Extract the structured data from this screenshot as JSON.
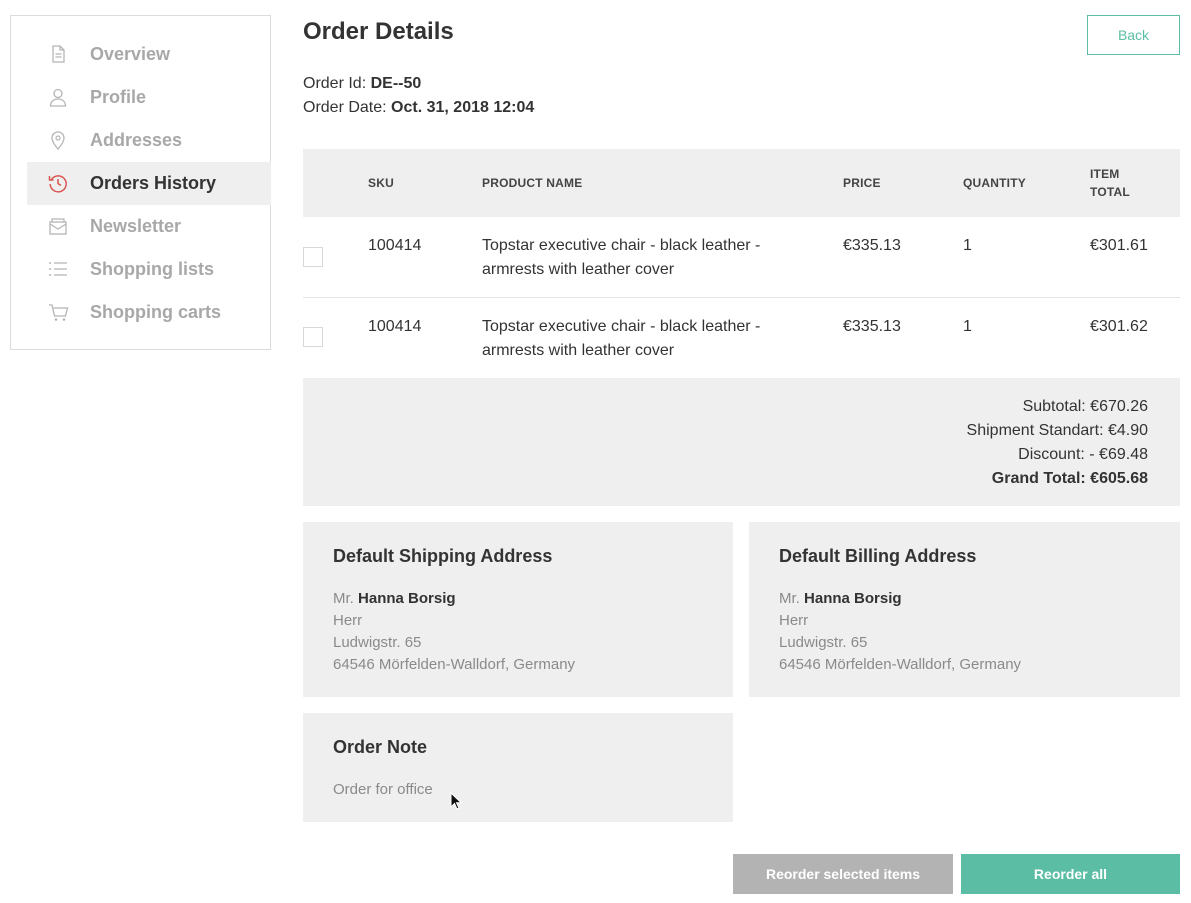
{
  "sidebar": {
    "items": [
      {
        "label": "Overview",
        "icon": "document-icon",
        "active": false
      },
      {
        "label": "Profile",
        "icon": "user-icon",
        "active": false
      },
      {
        "label": "Addresses",
        "icon": "location-pin-icon",
        "active": false
      },
      {
        "label": "Orders History",
        "icon": "history-icon",
        "active": true
      },
      {
        "label": "Newsletter",
        "icon": "envelope-icon",
        "active": false
      },
      {
        "label": "Shopping lists",
        "icon": "list-icon",
        "active": false
      },
      {
        "label": "Shopping carts",
        "icon": "cart-icon",
        "active": false
      }
    ]
  },
  "header": {
    "title": "Order Details",
    "back_label": "Back"
  },
  "order": {
    "id_label": "Order Id:",
    "id_value": "DE--50",
    "date_label": "Order Date:",
    "date_value": "Oct. 31, 2018 12:04"
  },
  "table": {
    "columns": [
      "SKU",
      "PRODUCT NAME",
      "PRICE",
      "QUANTITY",
      "ITEM",
      "TOTAL"
    ],
    "rows": [
      {
        "sku": "100414",
        "name_line1": "Topstar executive chair - black leather -",
        "name_line2": "armrests with leather cover",
        "price": "€335.13",
        "quantity": "1",
        "total": "€301.61"
      },
      {
        "sku": "100414",
        "name_line1": "Topstar executive chair - black leather -",
        "name_line2": "armrests with leather cover",
        "price": "€335.13",
        "quantity": "1",
        "total": "€301.62"
      }
    ]
  },
  "totals": {
    "subtotal": "Subtotal: €670.26",
    "shipment": "Shipment Standart: €4.90",
    "discount": "Discount: - €69.48",
    "grand_total": "Grand Total: €605.68"
  },
  "shipping": {
    "title": "Default Shipping Address",
    "salutation": "Mr.",
    "name": "Hanna Borsig",
    "line1": "Herr",
    "line2": "Ludwigstr. 65",
    "line3": "64546 Mörfelden-Walldorf, Germany"
  },
  "billing": {
    "title": "Default Billing Address",
    "salutation": "Mr.",
    "name": "Hanna Borsig",
    "line1": "Herr",
    "line2": "Ludwigstr. 65",
    "line3": "64546 Mörfelden-Walldorf, Germany"
  },
  "note": {
    "title": "Order Note",
    "text": "Order for office"
  },
  "actions": {
    "reorder_selected": "Reorder selected items",
    "reorder_all": "Reorder all"
  },
  "colors": {
    "accent": "#5bbea4",
    "active_icon": "#d9534f",
    "panel": "#efefef"
  }
}
